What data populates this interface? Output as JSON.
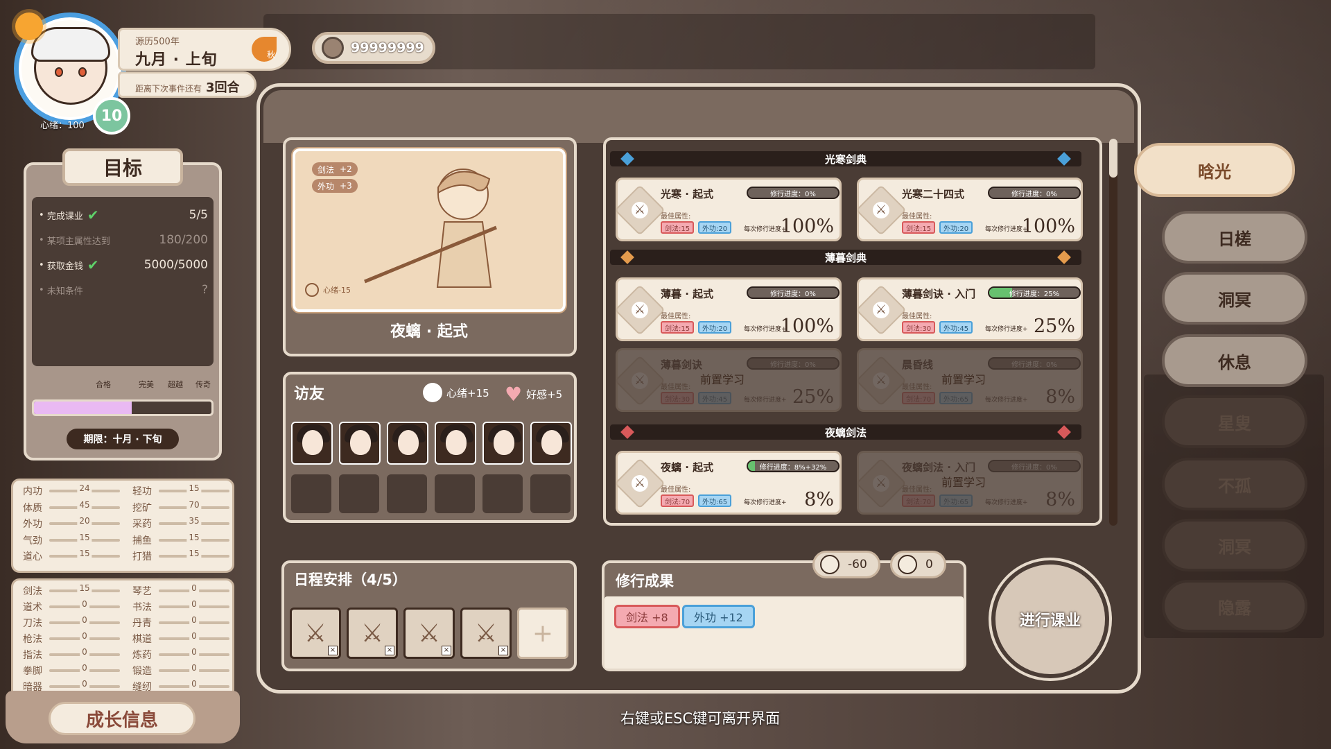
{
  "player": {
    "mood_label": "心绪：100",
    "level": "10"
  },
  "calendar": {
    "year": "源历500年",
    "date": "九月 · 上旬",
    "season": "秋",
    "next_event_prefix": "距离下次事件还有",
    "next_event_rounds": "3回合"
  },
  "currency": {
    "coins": "99999999"
  },
  "goal": {
    "title": "目标",
    "items": [
      {
        "label": "完成课业",
        "value": "5/5",
        "done": true
      },
      {
        "label": "某项主属性达到",
        "value": "180/200",
        "done": false
      },
      {
        "label": "获取金钱",
        "value": "5000/5000",
        "done": true
      },
      {
        "label": "未知条件",
        "value": "?",
        "done": false
      }
    ],
    "tiers": [
      "合格",
      "完美",
      "超越",
      "传奇"
    ],
    "progress": 0.55,
    "deadline": "期限：十月 · 下旬"
  },
  "stats_main": [
    {
      "name": "内功",
      "value": "24"
    },
    {
      "name": "轻功",
      "value": "15"
    },
    {
      "name": "体质",
      "value": "45"
    },
    {
      "name": "挖矿",
      "value": "70"
    },
    {
      "name": "外功",
      "value": "20"
    },
    {
      "name": "采药",
      "value": "35"
    },
    {
      "name": "气劲",
      "value": "15"
    },
    {
      "name": "捕鱼",
      "value": "15"
    },
    {
      "name": "道心",
      "value": "15"
    },
    {
      "name": "打猎",
      "value": "15"
    }
  ],
  "stats_skill": [
    {
      "name": "剑法",
      "value": "15"
    },
    {
      "name": "琴艺",
      "value": "0"
    },
    {
      "name": "道术",
      "value": "0"
    },
    {
      "name": "书法",
      "value": "0"
    },
    {
      "name": "刀法",
      "value": "0"
    },
    {
      "name": "丹青",
      "value": "0"
    },
    {
      "name": "枪法",
      "value": "0"
    },
    {
      "name": "棋道",
      "value": "0"
    },
    {
      "name": "指法",
      "value": "0"
    },
    {
      "name": "炼药",
      "value": "0"
    },
    {
      "name": "拳脚",
      "value": "0"
    },
    {
      "name": "锻造",
      "value": "0"
    },
    {
      "name": "暗器",
      "value": "0"
    },
    {
      "name": "缝纫",
      "value": "0"
    }
  ],
  "growth_button": "成长信息",
  "selected_course": {
    "name": "夜螭 · 起式",
    "tags": [
      {
        "name": "剑法",
        "val": "+2"
      },
      {
        "name": "外功",
        "val": "+3"
      }
    ],
    "mood": "心绪-15"
  },
  "visit": {
    "title": "访友",
    "mood": "心绪+15",
    "favor": "好感+5"
  },
  "categories": [
    "光寒剑典",
    "薄暮剑典",
    "夜螭剑法"
  ],
  "courses": [
    {
      "name": "光寒 · 起式",
      "progress_label": "修行进度：0%",
      "progress": 0,
      "best_label": "最佳属性:",
      "c1": "剑法:15",
      "c2": "外功:20",
      "per": "每次修行进度+",
      "pct": "100%"
    },
    {
      "name": "光寒二十四式",
      "progress_label": "修行进度：0%",
      "progress": 0,
      "best_label": "最佳属性:",
      "c1": "剑法:15",
      "c2": "外功:20",
      "per": "每次修行进度+",
      "pct": "100%"
    },
    {
      "name": "薄暮 · 起式",
      "progress_label": "修行进度：0%",
      "progress": 0,
      "best_label": "最佳属性:",
      "c1": "剑法:15",
      "c2": "外功:20",
      "per": "每次修行进度+",
      "pct": "100%"
    },
    {
      "name": "薄暮剑诀 · 入门",
      "progress_label": "修行进度：25%",
      "progress": 0.25,
      "best_label": "最佳属性:",
      "c1": "剑法:30",
      "c2": "外功:45",
      "per": "每次修行进度+",
      "pct": "25%"
    },
    {
      "name": "薄暮剑诀",
      "progress_label": "修行进度：0%",
      "progress": 0,
      "best_label": "最佳属性:",
      "c1": "剑法:30",
      "c2": "外功:45",
      "per": "每次修行进度+",
      "pct": "25%",
      "locked": "前置学习"
    },
    {
      "name": "晨昏线",
      "progress_label": "修行进度：0%",
      "progress": 0,
      "best_label": "最佳属性:",
      "c1": "剑法:70",
      "c2": "外功:65",
      "per": "每次修行进度+",
      "pct": "8%",
      "locked": "前置学习"
    },
    {
      "name": "夜螭 · 起式",
      "progress_label": "修行进度：8%+32%",
      "progress": 0.08,
      "best_label": "最佳属性:",
      "c1": "剑法:70",
      "c2": "外功:65",
      "per": "每次修行进度+",
      "pct": "8%"
    },
    {
      "name": "夜螭剑法 · 入门",
      "progress_label": "修行进度：0%",
      "progress": 0,
      "best_label": "最佳属性:",
      "c1": "剑法:70",
      "c2": "外功:65",
      "per": "每次修行进度+",
      "pct": "8%",
      "locked": "前置学习"
    }
  ],
  "schedule": {
    "title": "日程安排（4/5）",
    "add": "+"
  },
  "result": {
    "title": "修行成果",
    "tag1": "剑法 +8",
    "tag2": "外功 +12",
    "mood_cost": "-60",
    "coin_cost": "0"
  },
  "proceed_button": "进行课业",
  "tabs": [
    "晗光",
    "日槎",
    "洞冥",
    "休息",
    "星叟",
    "不孤",
    "洞冥",
    "隐露"
  ],
  "hint": "右键或ESC键可离开界面"
}
